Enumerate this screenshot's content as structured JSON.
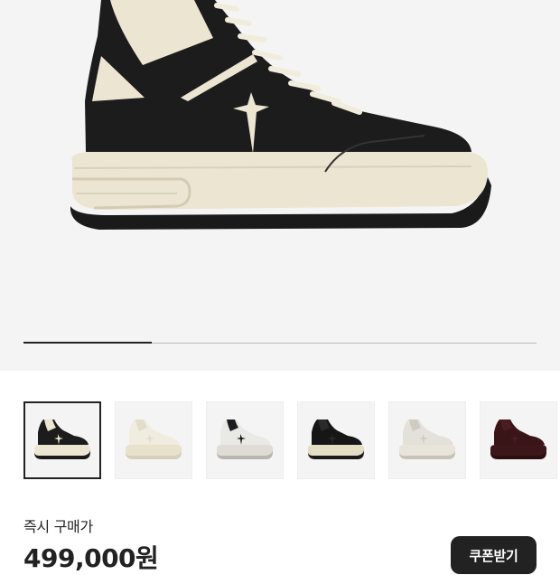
{
  "product": {
    "images_count": 6,
    "selected_index": 0,
    "gallery_progress": 0.25,
    "thumbnails": [
      {
        "name": "thumb-black-cream",
        "colorway": "black-cream"
      },
      {
        "name": "thumb-cream-white",
        "colorway": "cream-white"
      },
      {
        "name": "thumb-white-black",
        "colorway": "white-black"
      },
      {
        "name": "thumb-all-black",
        "colorway": "all-black"
      },
      {
        "name": "thumb-pearl-grey",
        "colorway": "pearl-grey"
      },
      {
        "name": "thumb-burgundy",
        "colorway": "burgundy"
      }
    ]
  },
  "price": {
    "label": "즉시 구매가",
    "value": "499,000원"
  },
  "coupon_button": {
    "label": "쿠폰받기"
  },
  "colors": {
    "hero_bg": "#f4f4f4",
    "shoe_black": "#1c1c1c",
    "shoe_cream": "#ece5d1",
    "button_bg": "#222222"
  }
}
